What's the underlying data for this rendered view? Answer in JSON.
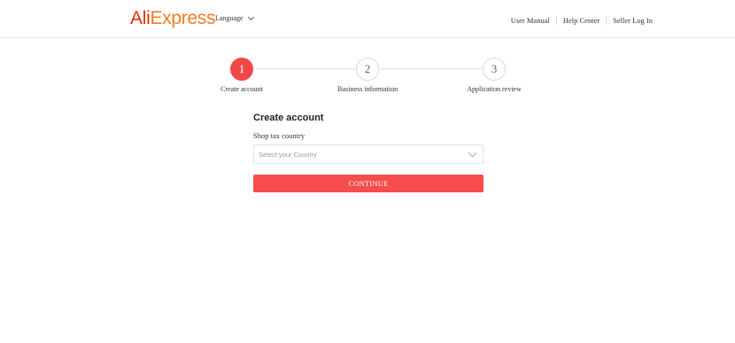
{
  "header": {
    "logo": {
      "part1": "Ali",
      "part2": "Express",
      "tm": "™"
    },
    "language_label": "Language",
    "nav": [
      "User Manual",
      "Help Center",
      "Seller Log In"
    ]
  },
  "stepper": {
    "steps": [
      {
        "number": "1",
        "label": "Create account",
        "state": "active"
      },
      {
        "number": "2",
        "label": "Business information",
        "state": "inactive"
      },
      {
        "number": "3",
        "label": "Application review",
        "state": "inactive"
      }
    ]
  },
  "form": {
    "title": "Create account",
    "field_label": "Shop tax country",
    "select_placeholder": "Select your Country",
    "button_label": "CONTINUE"
  },
  "colors": {
    "accent": "#f64c4c",
    "logo_red": "#e62e04",
    "logo_orange": "#f47c20"
  }
}
